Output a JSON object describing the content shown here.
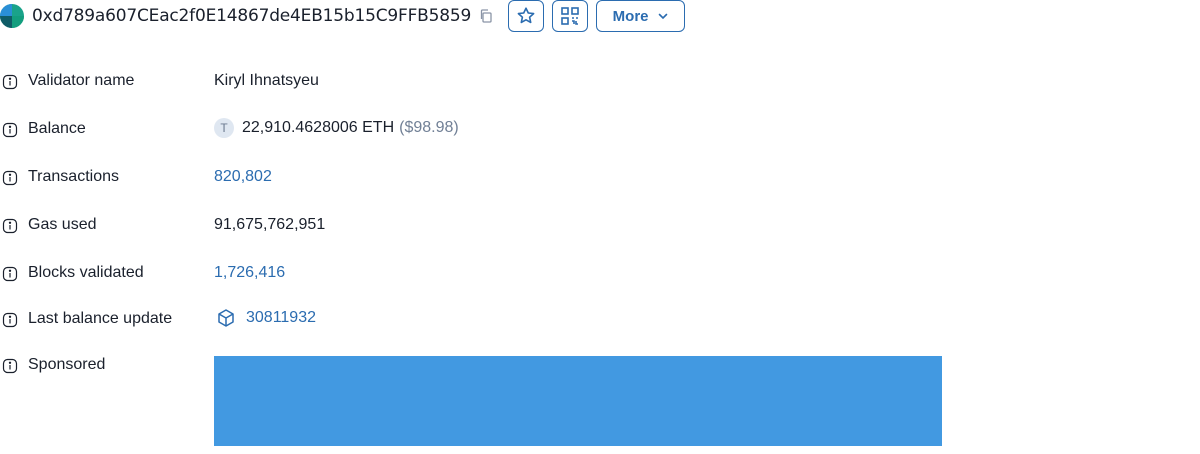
{
  "header": {
    "address": "0xd789a607CEac2f0E14867de4EB15b15C9FFB5859",
    "more_label": "More"
  },
  "details": {
    "validator_name": {
      "label": "Validator name",
      "value": "Kiryl Ihnatsyeu"
    },
    "balance": {
      "label": "Balance",
      "token_letter": "T",
      "amount": "22,910.4628006 ETH",
      "usd": "($98.98)"
    },
    "transactions": {
      "label": "Transactions",
      "value": "820,802"
    },
    "gas_used": {
      "label": "Gas used",
      "value": "91,675,762,951"
    },
    "blocks_validated": {
      "label": "Blocks validated",
      "value": "1,726,416"
    },
    "last_balance_update": {
      "label": "Last balance update",
      "value": "30811932"
    },
    "sponsored": {
      "label": "Sponsored"
    }
  },
  "colors": {
    "link": "#2b6cb0",
    "banner": "#4299e1"
  },
  "icons": [
    "avatar-identicon",
    "copy-icon",
    "star-icon",
    "qr-code-icon",
    "chevron-down-icon",
    "info-icon",
    "block-cube-icon"
  ]
}
